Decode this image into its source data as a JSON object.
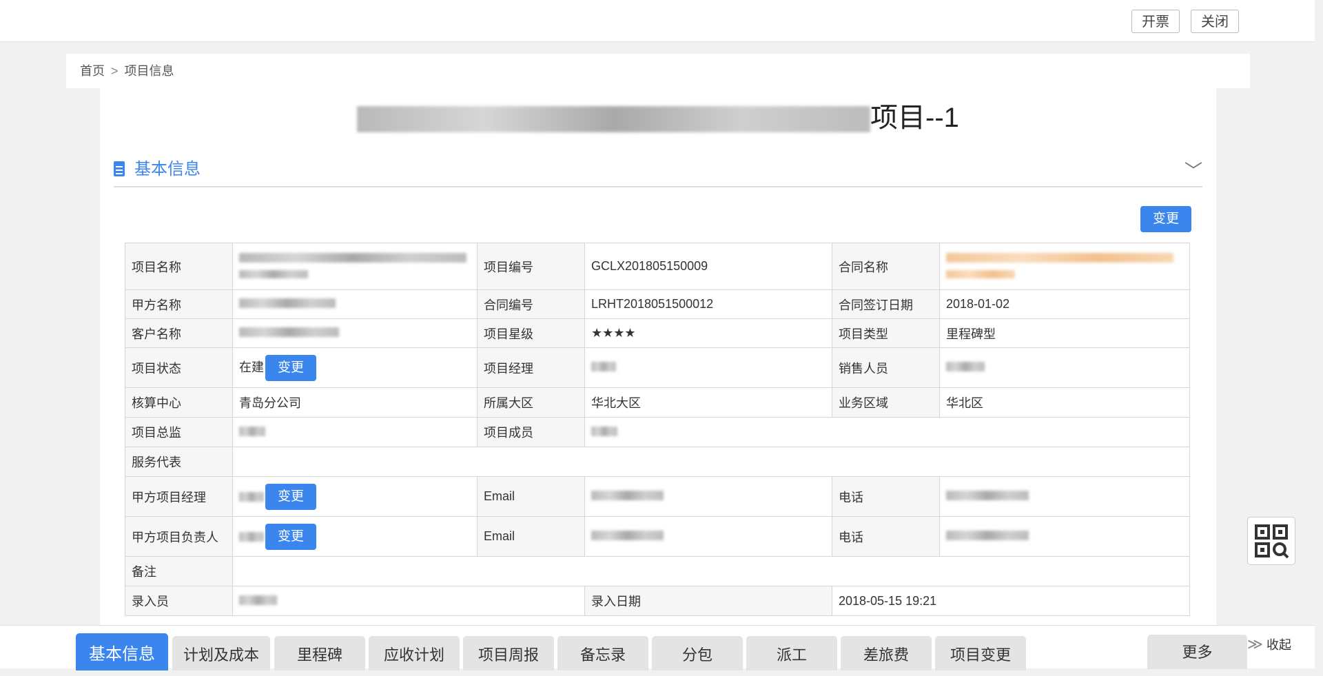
{
  "topbar": {
    "invoice_label": "开票",
    "close_label": "关闭"
  },
  "breadcrumb": {
    "home": "首页",
    "separator": ">",
    "current": "项目信息"
  },
  "title": {
    "suffix": "项目--1"
  },
  "section": {
    "label": "基本信息",
    "change_label": "变更"
  },
  "fields": {
    "project_name": "项目名称",
    "project_no": "项目编号",
    "project_no_val": "GCLX201805150009",
    "contract_name": "合同名称",
    "party_a_name": "甲方名称",
    "contract_no": "合同编号",
    "contract_no_val": "LRHT2018051500012",
    "contract_date": "合同签订日期",
    "contract_date_val": "2018-01-02",
    "customer_name": "客户名称",
    "star_level": "项目星级",
    "star_level_val": "★★★★",
    "project_type": "项目类型",
    "project_type_val": "里程碑型",
    "project_status": "项目状态",
    "project_status_val": "在建",
    "project_manager": "项目经理",
    "sales": "销售人员",
    "accounting_center": "核算中心",
    "accounting_center_val": "青岛分公司",
    "region": "所属大区",
    "region_val": "华北大区",
    "business_area": "业务区域",
    "business_area_val": "华北区",
    "director": "项目总监",
    "members": "项目成员",
    "service_rep": "服务代表",
    "party_a_pm": "甲方项目经理",
    "email": "Email",
    "phone": "电话",
    "party_a_owner": "甲方项目负责人",
    "remark": "备注",
    "entered_by": "录入员",
    "entry_date": "录入日期",
    "entry_date_val": "2018-05-15 19:21",
    "change_btn": "变更"
  },
  "tabs": [
    "基本信息",
    "计划及成本",
    "里程碑",
    "应收计划",
    "项目周报",
    "备忘录",
    "分包",
    "派工",
    "差旅费",
    "项目变更"
  ],
  "more_label": "更多",
  "collapse_label": "收起",
  "colors": {
    "accent": "#3b86ee"
  }
}
